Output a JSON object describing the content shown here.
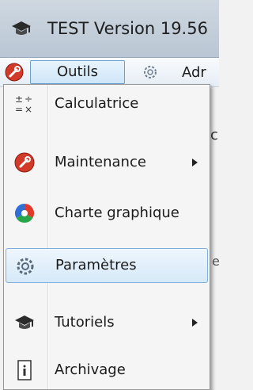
{
  "window": {
    "title": "TEST Version 19.56",
    "icon": "graduation-cap-icon"
  },
  "menubar": {
    "outils_label": "Outils",
    "outils_icon": "wrench-icon",
    "params_icon": "gear-icon",
    "next_label": "Adr"
  },
  "background": {
    "fragment_1": "c",
    "fragment_2": "e"
  },
  "menu": {
    "items": [
      {
        "label": "Calculatrice",
        "icon": "calculator-icon",
        "submenu": false,
        "highlighted": false
      },
      {
        "label": "Maintenance",
        "icon": "wrench-icon",
        "submenu": true,
        "highlighted": false
      },
      {
        "label": "Charte graphique",
        "icon": "color-palette-icon",
        "submenu": false,
        "highlighted": false
      },
      {
        "label": "Paramètres",
        "icon": "gear-icon",
        "submenu": false,
        "highlighted": true
      },
      {
        "label": "Tutoriels",
        "icon": "graduation-cap-icon",
        "submenu": true,
        "highlighted": false
      },
      {
        "label": "Archivage",
        "icon": "archive-icon",
        "submenu": false,
        "highlighted": false
      }
    ]
  },
  "colors": {
    "highlight": "#d6e9f8",
    "highlight_border": "#7fb0dd",
    "wrench_red": "#d23a2a"
  }
}
